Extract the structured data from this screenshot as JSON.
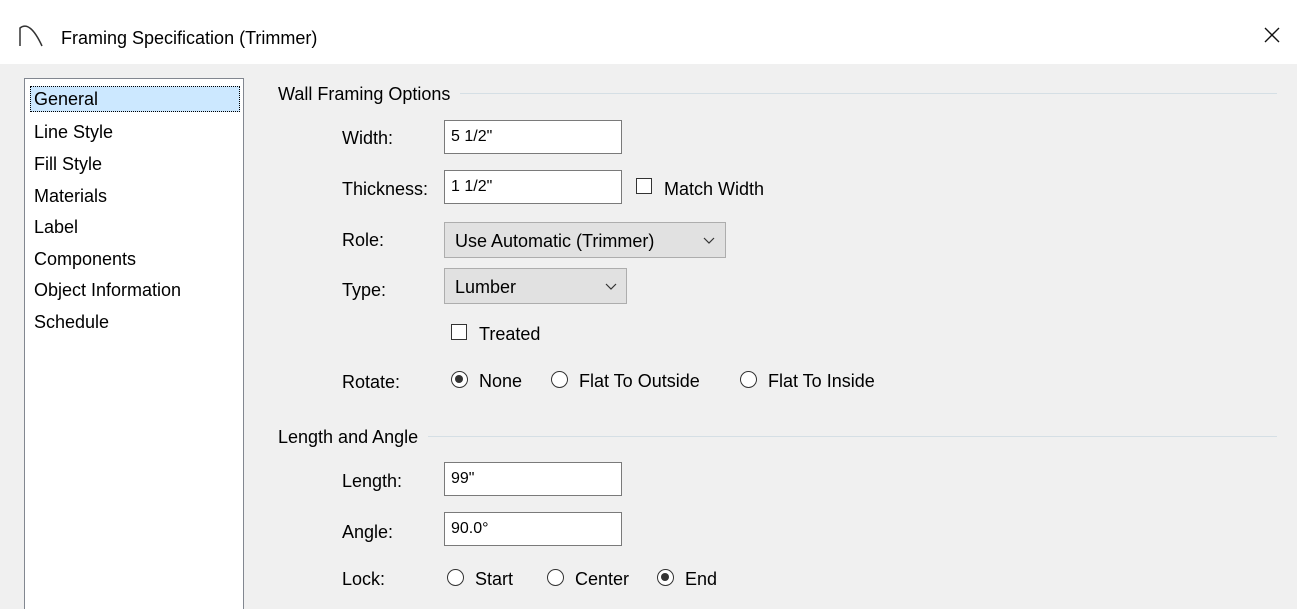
{
  "window": {
    "title": "Framing Specification (Trimmer)"
  },
  "nav": {
    "items": [
      "General",
      "Line Style",
      "Fill Style",
      "Materials",
      "Label",
      "Components",
      "Object Information",
      "Schedule"
    ],
    "selected": "General"
  },
  "wall_framing": {
    "title": "Wall Framing Options",
    "width_label": "Width:",
    "width_value": "5 1/2\"",
    "thickness_label": "Thickness:",
    "thickness_value": "1 1/2\"",
    "match_width_label": "Match Width",
    "match_width_checked": false,
    "role_label": "Role:",
    "role_value": "Use Automatic (Trimmer)",
    "type_label": "Type:",
    "type_value": "Lumber",
    "treated_label": "Treated",
    "treated_checked": false,
    "rotate_label": "Rotate:",
    "rotate_options": [
      "None",
      "Flat To Outside",
      "Flat To Inside"
    ],
    "rotate_selected": "None"
  },
  "length_angle": {
    "title": "Length and Angle",
    "length_label": "Length:",
    "length_value": "99\"",
    "angle_label": "Angle:",
    "angle_value": "90.0°",
    "lock_label": "Lock:",
    "lock_options": [
      "Start",
      "Center",
      "End"
    ],
    "lock_selected": "End"
  }
}
